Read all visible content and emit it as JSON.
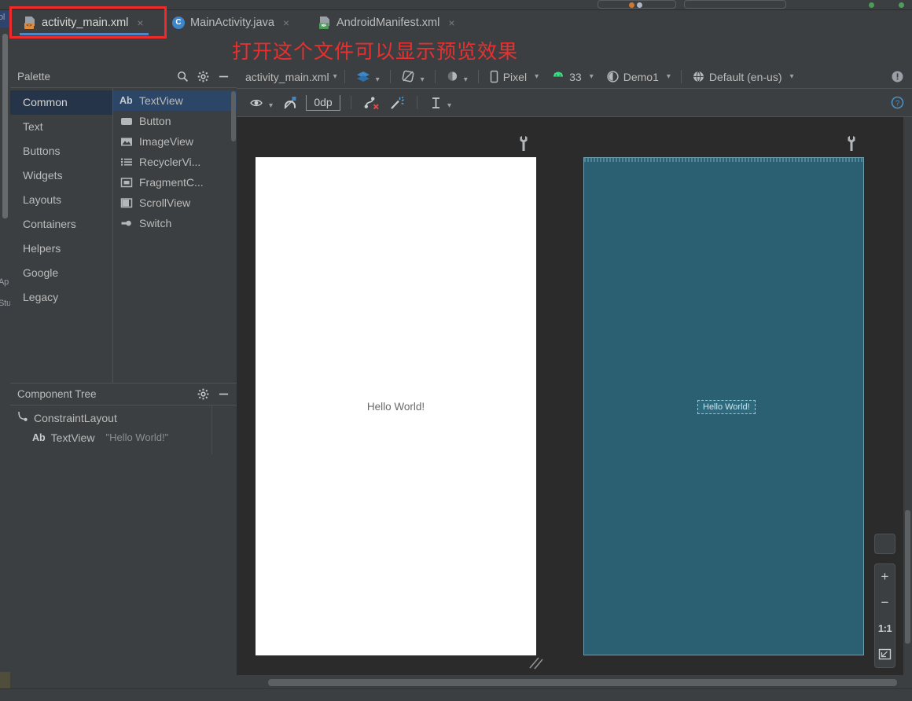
{
  "window": {
    "annotation_text": "打开这个文件可以显示预览效果",
    "annotation_color": "#e83030"
  },
  "tabs": [
    {
      "label": "activity_main.xml",
      "icon": "xml-layout-file-icon",
      "badge": "<>",
      "active": true,
      "close": "×"
    },
    {
      "label": "MainActivity.java",
      "icon": "java-class-icon",
      "badge": "C",
      "active": false,
      "close": "×"
    },
    {
      "label": "AndroidManifest.xml",
      "icon": "manifest-file-icon",
      "badge": "MF",
      "active": false,
      "close": "×"
    }
  ],
  "palette": {
    "title": "Palette",
    "search_icon": "search-icon",
    "settings_icon": "gear-icon",
    "minimize_icon": "minimize-icon",
    "categories": [
      {
        "label": "Common",
        "selected": true
      },
      {
        "label": "Text",
        "selected": false
      },
      {
        "label": "Buttons",
        "selected": false
      },
      {
        "label": "Widgets",
        "selected": false
      },
      {
        "label": "Layouts",
        "selected": false
      },
      {
        "label": "Containers",
        "selected": false
      },
      {
        "label": "Helpers",
        "selected": false
      },
      {
        "label": "Google",
        "selected": false
      },
      {
        "label": "Legacy",
        "selected": false
      }
    ],
    "items": [
      {
        "label": "TextView",
        "icon": "textview-icon",
        "glyph": "Ab",
        "selected": true
      },
      {
        "label": "Button",
        "icon": "button-icon",
        "glyph": "",
        "selected": false
      },
      {
        "label": "ImageView",
        "icon": "imageview-icon",
        "glyph": "",
        "selected": false
      },
      {
        "label": "RecyclerVi...",
        "icon": "recyclerview-icon",
        "glyph": "",
        "selected": false
      },
      {
        "label": "FragmentC...",
        "icon": "fragmentcontainer-icon",
        "glyph": "",
        "selected": false
      },
      {
        "label": "ScrollView",
        "icon": "scrollview-icon",
        "glyph": "",
        "selected": false
      },
      {
        "label": "Switch",
        "icon": "switch-icon",
        "glyph": "",
        "selected": false
      }
    ]
  },
  "component_tree": {
    "title": "Component Tree",
    "settings_icon": "gear-icon",
    "minimize_icon": "minimize-icon",
    "nodes": [
      {
        "label": "ConstraintLayout",
        "icon": "constraintlayout-icon",
        "glyph": "",
        "value": "",
        "indent": 0
      },
      {
        "label": "TextView",
        "icon": "textview-icon",
        "glyph": "Ab",
        "value": "\"Hello World!\"",
        "indent": 1
      }
    ]
  },
  "design_toolbar": {
    "file_label": "activity_main.xml",
    "dropdown_icon": "chevron-down-icon",
    "view_mode_icon": "design-surface-layers-icon",
    "orientation_icon": "rotate-orientation-icon",
    "theme_mode_icon": "night-mode-icon",
    "device_icon": "phone-icon",
    "device_label": "Pixel",
    "api_icon": "android-robot-icon",
    "api_label": "33",
    "theme_icon": "theme-contrast-icon",
    "theme_label": "Demo1",
    "locale_icon": "globe-icon",
    "locale_label": "Default (en-us)",
    "warning_icon": "warning-icon"
  },
  "constraint_toolbar": {
    "show_constraints_icon": "eye-icon",
    "autoconnect_icon": "magnet-off-icon",
    "default_margin_value": "0dp",
    "clear_constraints_icon": "clear-constraints-icon",
    "infer_constraints_icon": "magic-wand-icon",
    "align_icon": "align-vertical-icon",
    "help_icon": "help-icon"
  },
  "canvas": {
    "design_preview": {
      "name": "design-preview",
      "text": "Hello World!",
      "background": "#ffffff",
      "wrench_icon": "wrench-icon"
    },
    "blueprint_preview": {
      "name": "blueprint-preview",
      "text": "Hello World!",
      "background": "#2a6072",
      "wrench_icon": "wrench-icon"
    },
    "resize_handle_icon": "resize-handle-icon"
  },
  "zoom_controls": {
    "panel_icon": "pan-panel-icon",
    "zoom_in": "+",
    "zoom_out": "−",
    "actual_size": "1:1",
    "fit_screen_icon": "fit-to-screen-icon"
  },
  "left_rail": {
    "items": [
      {
        "label": "ol"
      },
      {
        "label": "Ap"
      },
      {
        "label": "Stu"
      }
    ]
  }
}
